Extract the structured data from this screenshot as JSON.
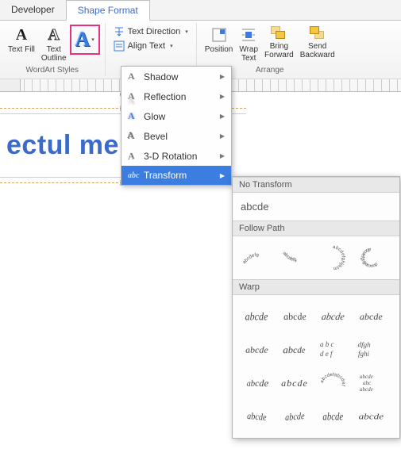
{
  "tabs": {
    "developer": "Developer",
    "shapeFormat": "Shape Format"
  },
  "ribbon": {
    "wordart": {
      "textFill": "Text Fill",
      "textOutline": "Text\nOutline",
      "groupLabel": "WordArt Styles"
    },
    "textOptions": {
      "direction": "Text Direction",
      "align": "Align Text"
    },
    "arrange": {
      "position": "Position",
      "wrap": "Wrap\nText",
      "forward": "Bring\nForward",
      "backward": "Send\nBackward",
      "groupLabel": "Arrange"
    }
  },
  "menu": {
    "shadow": "Shadow",
    "reflection": "Reflection",
    "glow": "Glow",
    "bevel": "Bevel",
    "rotation": "3-D Rotation",
    "transform": "Transform"
  },
  "submenu": {
    "noTransform": "No Transform",
    "noTransformSample": "abcde",
    "followPath": "Follow Path",
    "warp": "Warp",
    "warpSample": "abcde"
  },
  "canvas": {
    "wordart": "ectul meu Wor"
  }
}
